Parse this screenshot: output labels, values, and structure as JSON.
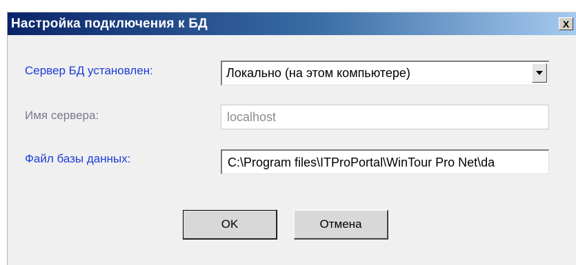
{
  "dialog": {
    "title": "Настройка подключения к БД",
    "close_label": "X"
  },
  "form": {
    "server_location": {
      "label": "Сервер БД установлен:",
      "selected": "Локально (на этом компьютере)"
    },
    "server_name": {
      "label": "Имя сервера:",
      "value": "localhost"
    },
    "db_file": {
      "label": "Файл базы данных:",
      "value": "C:\\Program files\\ITProPortal\\WinTour Pro Net\\da"
    }
  },
  "buttons": {
    "ok": "OK",
    "cancel": "Отмена"
  },
  "colors": {
    "label_active": "#1c3bd8",
    "label_disabled": "#7a7a8f",
    "title_bar_start": "#0a246a",
    "title_bar_end": "#a6caf0"
  }
}
